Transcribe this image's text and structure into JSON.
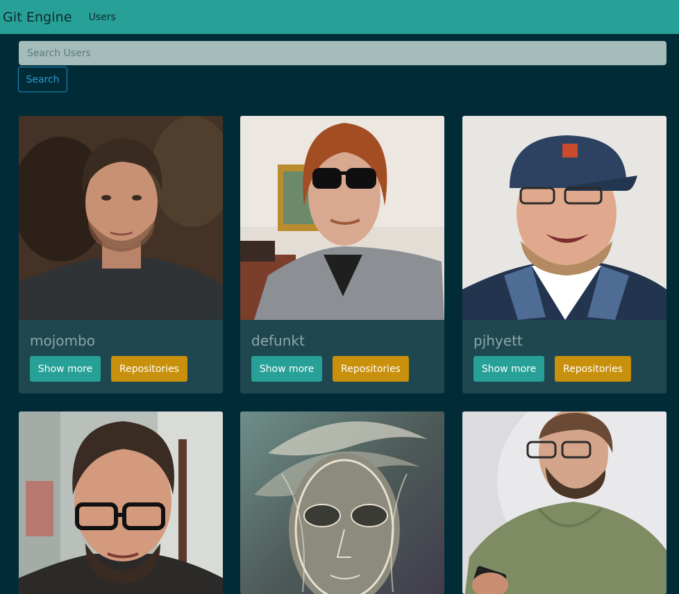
{
  "navbar": {
    "brand": "Git Engine",
    "users_link": "Users"
  },
  "search": {
    "placeholder": "Search Users",
    "value": "",
    "button_label": "Search"
  },
  "cards": [
    {
      "username": "mojombo",
      "show_more": "Show more",
      "repositories": "Repositories"
    },
    {
      "username": "defunkt",
      "show_more": "Show more",
      "repositories": "Repositories"
    },
    {
      "username": "pjhyett",
      "show_more": "Show more",
      "repositories": "Repositories"
    },
    {
      "username": "",
      "show_more": "",
      "repositories": ""
    },
    {
      "username": "",
      "show_more": "",
      "repositories": ""
    },
    {
      "username": "",
      "show_more": "",
      "repositories": ""
    }
  ],
  "colors": {
    "page_background": "#022b38",
    "navbar": "#27a197",
    "card": "#1f4750",
    "show_more_button": "#27a197",
    "repositories_button": "#c8900b",
    "search_button_outline": "#1c8fc2"
  }
}
